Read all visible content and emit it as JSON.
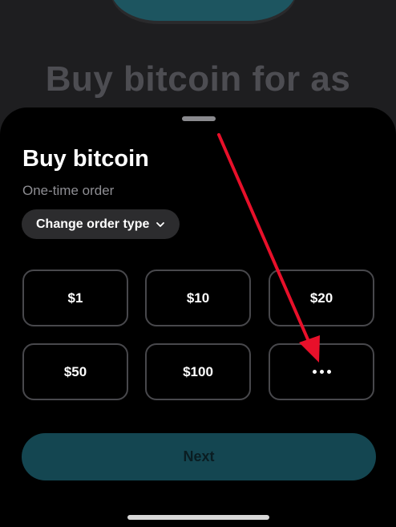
{
  "background": {
    "headline": "Buy bitcoin for as"
  },
  "sheet": {
    "title": "Buy bitcoin",
    "subtitle": "One-time order",
    "order_type_button": "Change order type",
    "amounts": [
      "$1",
      "$10",
      "$20",
      "$50",
      "$100"
    ],
    "more_button_icon": "ellipsis-icon",
    "next_button": "Next"
  },
  "colors": {
    "accent": "#144651",
    "annotation_arrow": "#e8102a",
    "sheet_background": "#000000"
  }
}
